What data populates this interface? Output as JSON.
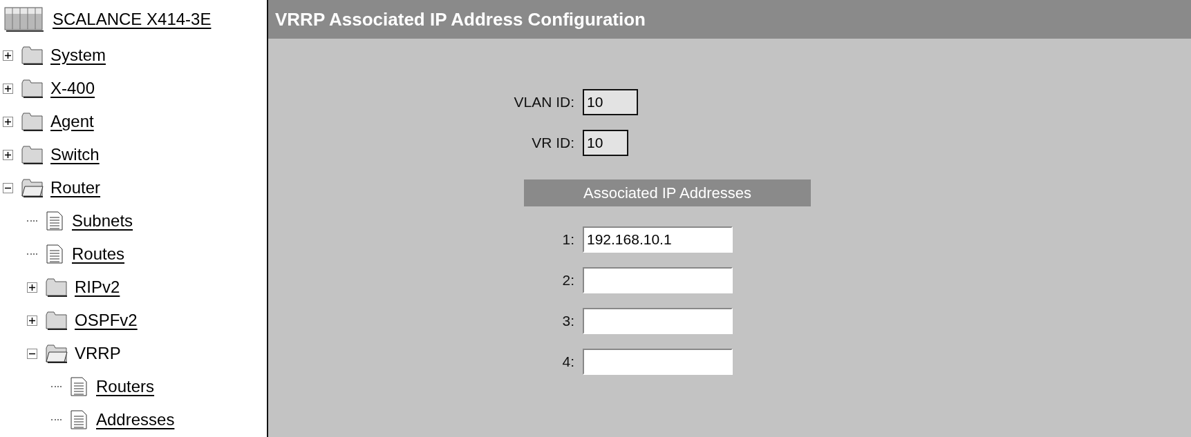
{
  "tree": {
    "root": {
      "label": "SCALANCE X414-3E"
    },
    "items": [
      {
        "label": "System",
        "kind": "folder",
        "expanded": false,
        "linked": true
      },
      {
        "label": "X-400",
        "kind": "folder",
        "expanded": false,
        "linked": true
      },
      {
        "label": "Agent",
        "kind": "folder",
        "expanded": false,
        "linked": true
      },
      {
        "label": "Switch",
        "kind": "folder",
        "expanded": false,
        "linked": true
      },
      {
        "label": "Router",
        "kind": "folder",
        "expanded": true,
        "linked": true,
        "children": [
          {
            "label": "Subnets",
            "kind": "page",
            "linked": true
          },
          {
            "label": "Routes",
            "kind": "page",
            "linked": true
          },
          {
            "label": "RIPv2",
            "kind": "folder",
            "expanded": false,
            "linked": true
          },
          {
            "label": "OSPFv2",
            "kind": "folder",
            "expanded": false,
            "linked": true
          },
          {
            "label": "VRRP",
            "kind": "folder",
            "expanded": true,
            "linked": false,
            "children": [
              {
                "label": "Routers",
                "kind": "page",
                "linked": true
              },
              {
                "label": "Addresses",
                "kind": "page",
                "linked": true
              }
            ]
          }
        ]
      }
    ]
  },
  "page": {
    "title": "VRRP Associated IP Address Configuration",
    "fields": [
      {
        "label": "VLAN ID:",
        "value": "10",
        "disabled": true
      },
      {
        "label": "VR ID:",
        "value": "10",
        "disabled": true
      }
    ],
    "section": {
      "title": "Associated IP Addresses",
      "addresses": [
        {
          "label": "1:",
          "value": "192.168.10.1"
        },
        {
          "label": "2:"
        },
        {
          "label": "3:"
        },
        {
          "label": "4:"
        }
      ]
    }
  }
}
